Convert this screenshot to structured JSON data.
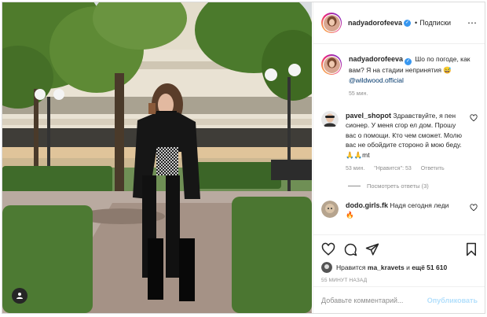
{
  "header": {
    "username": "nadyadorofeeva",
    "verified_mark": "✓",
    "separator": "•",
    "follow_label": "Подписки"
  },
  "caption": {
    "username": "nadyadorofeeva",
    "text": "Шо по погоде, как вам? Я на стадии непринятия",
    "emoji": "😅",
    "mention": "@wildwood.official",
    "time": "55 мин."
  },
  "comments": [
    {
      "username": "pavel_shopot",
      "text": "Здравствуйте, я пен сионер. У меня сгор ел дом. Прошу вас о помощи. Кто чем сможет. Молю вас не обойдите стороно й мою беду.🙏🙏mt",
      "time": "53 мин.",
      "likes": "\"Нравится\": 53",
      "reply": "Ответить",
      "view_replies": "Посмотреть ответы (3)"
    },
    {
      "username": "dodo.girls.fk",
      "text": "Надя сегодня леди",
      "emoji": "🔥"
    }
  ],
  "likes": {
    "prefix": "Нравится",
    "user": "ma_kravets",
    "middle": "и",
    "count": "ещё 51 610"
  },
  "post_time": "55 МИНУТ НАЗАД",
  "add_comment": {
    "placeholder": "Добавьте комментарий...",
    "publish": "Опубликовать"
  },
  "icons": [
    "heart-icon",
    "comment-icon",
    "share-icon",
    "bookmark-icon",
    "tag-icon"
  ],
  "colors": {
    "verified": "#3897f0",
    "mention": "#00376b",
    "muted": "#8e8e8e",
    "publish_disabled": "#b2dffc"
  }
}
